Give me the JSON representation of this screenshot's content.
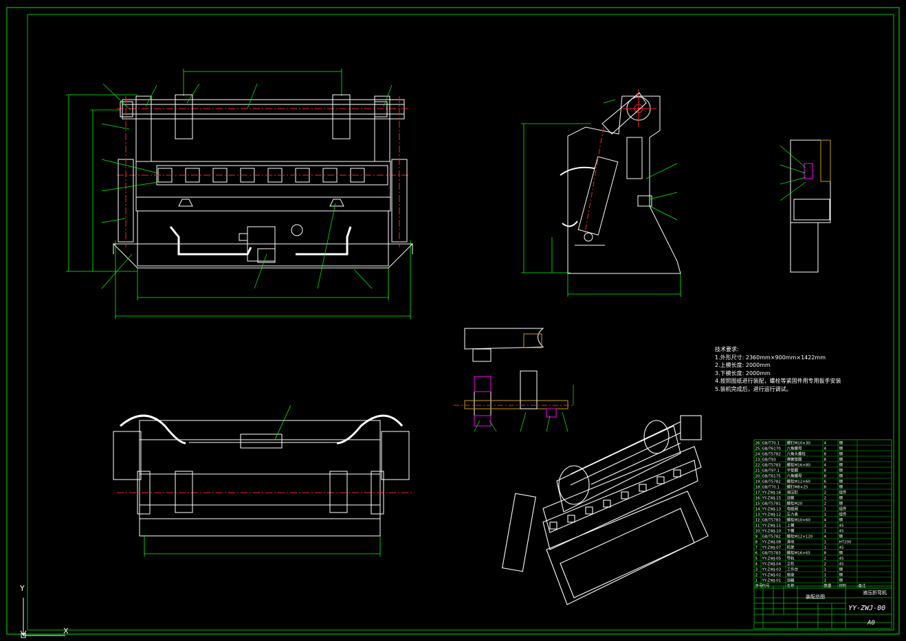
{
  "tech_requirements": {
    "title": "技术要求:",
    "items": [
      "1.外形尺寸: 2360mm×900mm×1422mm",
      "2.上模长度: 2000mm",
      "3.下模长度: 2000mm",
      "4.按照图纸进行装配，螺栓等紧固件用专用扳手安装",
      "5.装机完成后，进行运行调试。"
    ]
  },
  "title_block": {
    "drawing_title": "液压折弯机",
    "drawing_code": "YY-ZWJ-00",
    "sheet_size": "A0",
    "assembly_label": "装配总图"
  },
  "ucs": {
    "x_label": "X",
    "y_label": "Y"
  },
  "colors": {
    "background": "#000000",
    "outline": "#ffffff",
    "dimension": "#00ff00",
    "centerline": "#ff2020",
    "hidden": "#ffff00",
    "border": "#00c000",
    "hatch": "#c8a000",
    "highlight": "#ff00ff"
  },
  "bom": {
    "header": [
      "序号",
      "代号",
      "名称",
      "数量",
      "材料",
      "备注"
    ],
    "rows": [
      [
        "26",
        "GB/T70.1",
        "螺钉M10×30",
        "4",
        "钢",
        ""
      ],
      [
        "25",
        "GB/T6170",
        "六角螺母",
        "4",
        "钢",
        ""
      ],
      [
        "24",
        "GB/T5782",
        "六角头螺栓",
        "8",
        "钢",
        ""
      ],
      [
        "23",
        "GB/T93",
        "弹簧垫圈",
        "8",
        "钢",
        ""
      ],
      [
        "22",
        "GB/T5783",
        "螺栓M16×80",
        "4",
        "钢",
        ""
      ],
      [
        "21",
        "GB/T97.1",
        "平垫圈",
        "8",
        "钢",
        ""
      ],
      [
        "20",
        "GB/T6175",
        "六角螺母",
        "8",
        "钢",
        ""
      ],
      [
        "19",
        "GB/T5782",
        "螺栓M12×60",
        "6",
        "钢",
        ""
      ],
      [
        "18",
        "GB/T70.1",
        "螺钉M8×25",
        "8",
        "钢",
        ""
      ],
      [
        "17",
        "YY-ZWJ-16",
        "液压缸",
        "2",
        "组件",
        ""
      ],
      [
        "16",
        "YY-ZWJ-15",
        "油管",
        "2",
        "钢",
        ""
      ],
      [
        "15",
        "GB/T5781",
        "螺栓M20",
        "2",
        "钢",
        ""
      ],
      [
        "14",
        "YY-ZWJ-13",
        "电磁阀",
        "1",
        "组件",
        ""
      ],
      [
        "13",
        "YY-ZWJ-12",
        "压力表",
        "1",
        "组件",
        ""
      ],
      [
        "12",
        "GB/T5783",
        "螺栓M10×60",
        "4",
        "钢",
        ""
      ],
      [
        "11",
        "YY-ZWJ-11",
        "上模",
        "1",
        "45",
        ""
      ],
      [
        "10",
        "YY-ZWJ-10",
        "下模",
        "1",
        "45",
        ""
      ],
      [
        "9",
        "GB/T5782",
        "螺栓M12×120",
        "4",
        "钢",
        ""
      ],
      [
        "8",
        "YY-ZWJ-08",
        "滑块",
        "1",
        "HT200",
        ""
      ],
      [
        "7",
        "YY-ZWJ-07",
        "机架",
        "1",
        "45",
        ""
      ],
      [
        "6",
        "GB/T5783",
        "螺栓M16×65",
        "8",
        "钢",
        ""
      ],
      [
        "5",
        "YY-ZWJ-05",
        "导轨",
        "2",
        "45",
        ""
      ],
      [
        "4",
        "YY-ZWJ-04",
        "立柱",
        "2",
        "45",
        ""
      ],
      [
        "3",
        "YY-ZWJ-03",
        "工作台",
        "1",
        "钢",
        ""
      ],
      [
        "2",
        "YY-ZWJ-02",
        "底座",
        "1",
        "钢",
        ""
      ],
      [
        "1",
        "YY-ZWJ-01",
        "油箱",
        "1",
        "钢",
        ""
      ]
    ]
  }
}
